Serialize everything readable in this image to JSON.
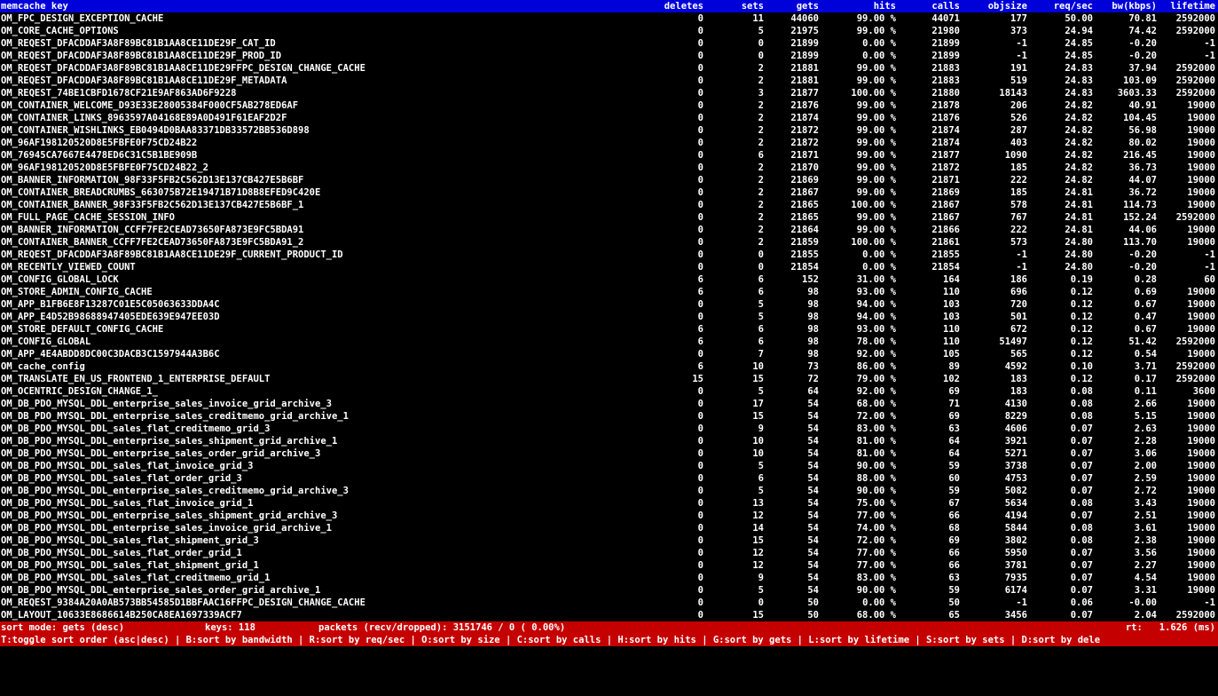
{
  "header": {
    "key": "memcache key",
    "deletes": "deletes",
    "sets": "sets",
    "gets": "gets",
    "hits": "hits",
    "calls": "calls",
    "objsize": "objsize",
    "reqsec": "req/sec",
    "bw": "bw(kbps)",
    "lifetime": "lifetime"
  },
  "rows": [
    [
      "OM_FPC_DESIGN_EXCEPTION_CACHE",
      "0",
      "11",
      "44060",
      "99.00 %",
      "44071",
      "177",
      "50.00",
      "70.81",
      "2592000"
    ],
    [
      "OM_CORE_CACHE_OPTIONS",
      "0",
      "5",
      "21975",
      "99.00 %",
      "21980",
      "373",
      "24.94",
      "74.42",
      "2592000"
    ],
    [
      "OM_REQEST_DFACDDAF3A8F89BC81B1AA8CE11DE29F_CAT_ID",
      "0",
      "0",
      "21899",
      "0.00 %",
      "21899",
      "-1",
      "24.85",
      "-0.20",
      "-1"
    ],
    [
      "OM_REQEST_DFACDDAF3A8F89BC81B1AA8CE11DE29F_PROD_ID",
      "0",
      "0",
      "21899",
      "0.00 %",
      "21899",
      "-1",
      "24.85",
      "-0.20",
      "-1"
    ],
    [
      "OM_REQEST_DFACDDAF3A8F89BC81B1AA8CE11DE29FFPC_DESIGN_CHANGE_CACHE",
      "0",
      "2",
      "21881",
      "99.00 %",
      "21883",
      "191",
      "24.83",
      "37.94",
      "2592000"
    ],
    [
      "OM_REQEST_DFACDDAF3A8F89BC81B1AA8CE11DE29F_METADATA",
      "0",
      "2",
      "21881",
      "99.00 %",
      "21883",
      "519",
      "24.83",
      "103.09",
      "2592000"
    ],
    [
      "OM_REQEST_74BE1CBFD1678CF21E9AF863AD6F9228",
      "0",
      "3",
      "21877",
      "100.00 %",
      "21880",
      "18143",
      "24.83",
      "3603.33",
      "2592000"
    ],
    [
      "OM_CONTAINER_WELCOME_D93E33E28005384F000CF5AB278ED6AF",
      "0",
      "2",
      "21876",
      "99.00 %",
      "21878",
      "206",
      "24.82",
      "40.91",
      "19000"
    ],
    [
      "OM_CONTAINER_LINKS_8963597A04168E89A0D491F61EAF2D2F",
      "0",
      "2",
      "21874",
      "99.00 %",
      "21876",
      "526",
      "24.82",
      "104.45",
      "19000"
    ],
    [
      "OM_CONTAINER_WISHLINKS_EB0494D0BAA83371DB33572BB536D898",
      "0",
      "2",
      "21872",
      "99.00 %",
      "21874",
      "287",
      "24.82",
      "56.98",
      "19000"
    ],
    [
      "OM_96AF198120520D8E5FBFE0F75CD24B22",
      "0",
      "2",
      "21872",
      "99.00 %",
      "21874",
      "403",
      "24.82",
      "80.02",
      "19000"
    ],
    [
      "OM_76945CA7667E4478ED6C31C5B1BE909B",
      "0",
      "6",
      "21871",
      "99.00 %",
      "21877",
      "1090",
      "24.82",
      "216.45",
      "19000"
    ],
    [
      "OM_96AF198120520D8E5FBFE0F75CD24B22_2",
      "0",
      "2",
      "21870",
      "99.00 %",
      "21872",
      "185",
      "24.82",
      "36.73",
      "19000"
    ],
    [
      "OM_BANNER_INFORMATION_98F33F5FB2C562D13E137CB427E5B6BF",
      "0",
      "2",
      "21869",
      "99.00 %",
      "21871",
      "222",
      "24.82",
      "44.07",
      "19000"
    ],
    [
      "OM_CONTAINER_BREADCRUMBS_663075B72E19471B71D8B8EFED9C420E",
      "0",
      "2",
      "21867",
      "99.00 %",
      "21869",
      "185",
      "24.81",
      "36.72",
      "19000"
    ],
    [
      "OM_CONTAINER_BANNER_98F33F5FB2C562D13E137CB427E5B6BF_1",
      "0",
      "2",
      "21865",
      "100.00 %",
      "21867",
      "578",
      "24.81",
      "114.73",
      "19000"
    ],
    [
      "OM_FULL_PAGE_CACHE_SESSION_INFO",
      "0",
      "2",
      "21865",
      "99.00 %",
      "21867",
      "767",
      "24.81",
      "152.24",
      "2592000"
    ],
    [
      "OM_BANNER_INFORMATION_CCFF7FE2CEAD73650FA873E9FC5BDA91",
      "0",
      "2",
      "21864",
      "99.00 %",
      "21866",
      "222",
      "24.81",
      "44.06",
      "19000"
    ],
    [
      "OM_CONTAINER_BANNER_CCFF7FE2CEAD73650FA873E9FC5BDA91_2",
      "0",
      "2",
      "21859",
      "100.00 %",
      "21861",
      "573",
      "24.80",
      "113.70",
      "19000"
    ],
    [
      "OM_REQEST_DFACDDAF3A8F89BC81B1AA8CE11DE29F_CURRENT_PRODUCT_ID",
      "0",
      "0",
      "21855",
      "0.00 %",
      "21855",
      "-1",
      "24.80",
      "-0.20",
      "-1"
    ],
    [
      "OM_RECENTLY_VIEWED_COUNT",
      "0",
      "0",
      "21854",
      "0.00 %",
      "21854",
      "-1",
      "24.80",
      "-0.20",
      "-1"
    ],
    [
      "OM_CONFIG_GLOBAL_LOCK",
      "6",
      "6",
      "152",
      "31.00 %",
      "164",
      "186",
      "0.19",
      "0.28",
      "60"
    ],
    [
      "OM_STORE_ADMIN_CONFIG_CACHE",
      "6",
      "6",
      "98",
      "93.00 %",
      "110",
      "696",
      "0.12",
      "0.69",
      "19000"
    ],
    [
      "OM_APP_B1FB6E8F13287C01E5C05063633DDA4C",
      "0",
      "5",
      "98",
      "94.00 %",
      "103",
      "720",
      "0.12",
      "0.67",
      "19000"
    ],
    [
      "OM_APP_E4D52B98688947405EDE639E947EE03D",
      "0",
      "5",
      "98",
      "94.00 %",
      "103",
      "501",
      "0.12",
      "0.47",
      "19000"
    ],
    [
      "OM_STORE_DEFAULT_CONFIG_CACHE",
      "6",
      "6",
      "98",
      "93.00 %",
      "110",
      "672",
      "0.12",
      "0.67",
      "19000"
    ],
    [
      "OM_CONFIG_GLOBAL",
      "6",
      "6",
      "98",
      "78.00 %",
      "110",
      "51497",
      "0.12",
      "51.42",
      "2592000"
    ],
    [
      "OM_APP_4E4ABDD8DC00C3DACB3C1597944A3B6C",
      "0",
      "7",
      "98",
      "92.00 %",
      "105",
      "565",
      "0.12",
      "0.54",
      "19000"
    ],
    [
      "OM_cache_config",
      "6",
      "10",
      "73",
      "86.00 %",
      "89",
      "4592",
      "0.10",
      "3.71",
      "2592000"
    ],
    [
      "OM_TRANSLATE_EN_US_FRONTEND_1_ENTERPRISE_DEFAULT",
      "15",
      "15",
      "72",
      "79.00 %",
      "102",
      "183",
      "0.12",
      "0.17",
      "2592000"
    ],
    [
      "OM_OCENTRIC_DESIGN_CHANGE_1_",
      "0",
      "5",
      "64",
      "92.00 %",
      "69",
      "183",
      "0.08",
      "0.11",
      "3600"
    ],
    [
      "OM_DB_PDO_MYSQL_DDL_enterprise_sales_invoice_grid_archive_3",
      "0",
      "17",
      "54",
      "68.00 %",
      "71",
      "4130",
      "0.08",
      "2.66",
      "19000"
    ],
    [
      "OM_DB_PDO_MYSQL_DDL_enterprise_sales_creditmemo_grid_archive_1",
      "0",
      "15",
      "54",
      "72.00 %",
      "69",
      "8229",
      "0.08",
      "5.15",
      "19000"
    ],
    [
      "OM_DB_PDO_MYSQL_DDL_sales_flat_creditmemo_grid_3",
      "0",
      "9",
      "54",
      "83.00 %",
      "63",
      "4606",
      "0.07",
      "2.63",
      "19000"
    ],
    [
      "OM_DB_PDO_MYSQL_DDL_enterprise_sales_shipment_grid_archive_1",
      "0",
      "10",
      "54",
      "81.00 %",
      "64",
      "3921",
      "0.07",
      "2.28",
      "19000"
    ],
    [
      "OM_DB_PDO_MYSQL_DDL_enterprise_sales_order_grid_archive_3",
      "0",
      "10",
      "54",
      "81.00 %",
      "64",
      "5271",
      "0.07",
      "3.06",
      "19000"
    ],
    [
      "OM_DB_PDO_MYSQL_DDL_sales_flat_invoice_grid_3",
      "0",
      "5",
      "54",
      "90.00 %",
      "59",
      "3738",
      "0.07",
      "2.00",
      "19000"
    ],
    [
      "OM_DB_PDO_MYSQL_DDL_sales_flat_order_grid_3",
      "0",
      "6",
      "54",
      "88.00 %",
      "60",
      "4753",
      "0.07",
      "2.59",
      "19000"
    ],
    [
      "OM_DB_PDO_MYSQL_DDL_enterprise_sales_creditmemo_grid_archive_3",
      "0",
      "5",
      "54",
      "90.00 %",
      "59",
      "5082",
      "0.07",
      "2.72",
      "19000"
    ],
    [
      "OM_DB_PDO_MYSQL_DDL_sales_flat_invoice_grid_1",
      "0",
      "13",
      "54",
      "75.00 %",
      "67",
      "5634",
      "0.08",
      "3.43",
      "19000"
    ],
    [
      "OM_DB_PDO_MYSQL_DDL_enterprise_sales_shipment_grid_archive_3",
      "0",
      "12",
      "54",
      "77.00 %",
      "66",
      "4194",
      "0.07",
      "2.51",
      "19000"
    ],
    [
      "OM_DB_PDO_MYSQL_DDL_enterprise_sales_invoice_grid_archive_1",
      "0",
      "14",
      "54",
      "74.00 %",
      "68",
      "5844",
      "0.08",
      "3.61",
      "19000"
    ],
    [
      "OM_DB_PDO_MYSQL_DDL_sales_flat_shipment_grid_3",
      "0",
      "15",
      "54",
      "72.00 %",
      "69",
      "3802",
      "0.08",
      "2.38",
      "19000"
    ],
    [
      "OM_DB_PDO_MYSQL_DDL_sales_flat_order_grid_1",
      "0",
      "12",
      "54",
      "77.00 %",
      "66",
      "5950",
      "0.07",
      "3.56",
      "19000"
    ],
    [
      "OM_DB_PDO_MYSQL_DDL_sales_flat_shipment_grid_1",
      "0",
      "12",
      "54",
      "77.00 %",
      "66",
      "3781",
      "0.07",
      "2.27",
      "19000"
    ],
    [
      "OM_DB_PDO_MYSQL_DDL_sales_flat_creditmemo_grid_1",
      "0",
      "9",
      "54",
      "83.00 %",
      "63",
      "7935",
      "0.07",
      "4.54",
      "19000"
    ],
    [
      "OM_DB_PDO_MYSQL_DDL_enterprise_sales_order_grid_archive_1",
      "0",
      "5",
      "54",
      "90.00 %",
      "59",
      "6174",
      "0.07",
      "3.31",
      "19000"
    ],
    [
      "OM_REQEST_9384A20A0AB573BB54585D1BBFAAC16FFPC_DESIGN_CHANGE_CACHE",
      "0",
      "0",
      "50",
      "0.00 %",
      "50",
      "-1",
      "0.06",
      "-0.00",
      "-1"
    ],
    [
      "OM_LAYOUT_10633E8686614B250CA8EA1697339ACF7",
      "0",
      "15",
      "50",
      "68.00 %",
      "65",
      "3456",
      "0.07",
      "2.04",
      "2592000"
    ]
  ],
  "status": {
    "sort_mode": "sort mode: gets (desc)",
    "keys": "keys: 118",
    "packets": "packets (recv/dropped): 3151746 / 0 ( 0.00%)",
    "rt": "rt:   1.626 (ms)"
  },
  "help": {
    "text": "T:toggle sort order (asc|desc) | B:sort by bandwidth | R:sort by req/sec | O:sort by size | C:sort by calls | H:sort by hits | G:sort by gets | L:sort by lifetime | S:sort by sets | D:sort by dele"
  },
  "colors": {
    "header_bg": "#0000d8",
    "status_bg": "#c40000",
    "background": "#000000",
    "text": "#ffffff"
  }
}
